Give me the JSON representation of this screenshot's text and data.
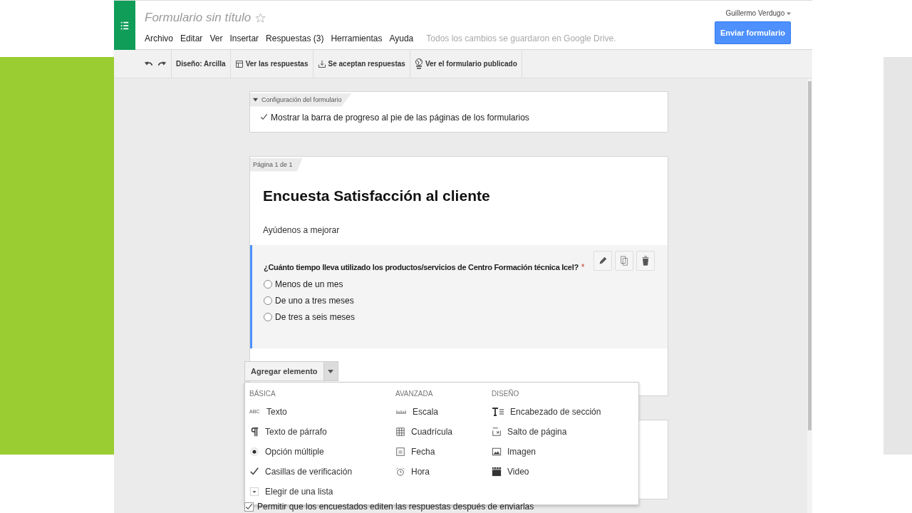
{
  "app": {
    "title": "Formulario sin título",
    "starred": false,
    "user": "Guillermo Verdugo",
    "send_button": "Enviar formulario",
    "save_status": "Todos los cambios se guardaron en Google Drive.",
    "menu": [
      "Archivo",
      "Editar",
      "Ver",
      "Insertar",
      "Respuestas (3)",
      "Herramientas",
      "Ayuda"
    ]
  },
  "toolbar": [
    {
      "kind": "undo"
    },
    {
      "kind": "redo"
    },
    {
      "kind": "text",
      "label": "Diseño: Arcilla"
    },
    {
      "kind": "table",
      "label": "Ver las respuestas"
    },
    {
      "kind": "download",
      "label": "Se aceptan respuestas"
    },
    {
      "kind": "globe",
      "label": "Ver el formulario publicado"
    }
  ],
  "settings": {
    "label": "Configuración del formulario",
    "expanded": true,
    "progress_bar": {
      "label": "Mostrar la barra de progreso al pie de las páginas de los formularios",
      "checked": true
    }
  },
  "page": {
    "tab": "Página 1 de 1",
    "title": "Encuesta Satisfacción al cliente",
    "description": "Ayúdenos a mejorar",
    "question": {
      "text": "¿Cuánto tiempo lleva utilizado los productos/servicios de Centro Formación técnica Icel?",
      "required": true,
      "required_mark": "*",
      "options": [
        {
          "label": "Menos de un mes",
          "selected": false
        },
        {
          "label": "De uno a tres meses",
          "selected": false
        },
        {
          "label": "De tres a seis meses",
          "selected": false
        }
      ]
    }
  },
  "add_item": {
    "label": "Agregar elemento",
    "expanded": true,
    "columns": [
      {
        "heading": "BÁSICA",
        "items": [
          {
            "label": "Texto",
            "kind": "abc",
            "icon_text": "ABC"
          },
          {
            "label": "Texto de párrafo",
            "kind": "pilcrow"
          },
          {
            "label": "Opción múltiple",
            "kind": "radio"
          },
          {
            "label": "Casillas de verificación",
            "kind": "check"
          },
          {
            "label": "Elegir de una lista",
            "kind": "list"
          }
        ]
      },
      {
        "heading": "AVANZADA",
        "items": [
          {
            "label": "Escala",
            "kind": "scale"
          },
          {
            "label": "Cuadrícula",
            "kind": "grid"
          },
          {
            "label": "Fecha",
            "kind": "date"
          },
          {
            "label": "Hora",
            "kind": "clock"
          }
        ]
      },
      {
        "heading": "DISEÑO",
        "items": [
          {
            "label": "Encabezado de sección",
            "kind": "header"
          },
          {
            "label": "Salto de página",
            "kind": "pagebreak"
          },
          {
            "label": "Imagen",
            "kind": "image"
          },
          {
            "label": "Video",
            "kind": "video"
          }
        ]
      }
    ]
  },
  "edit_after_submit": {
    "label": "Permitir que los encuestados editen las respuestas después de enviarlas",
    "checked": true
  }
}
